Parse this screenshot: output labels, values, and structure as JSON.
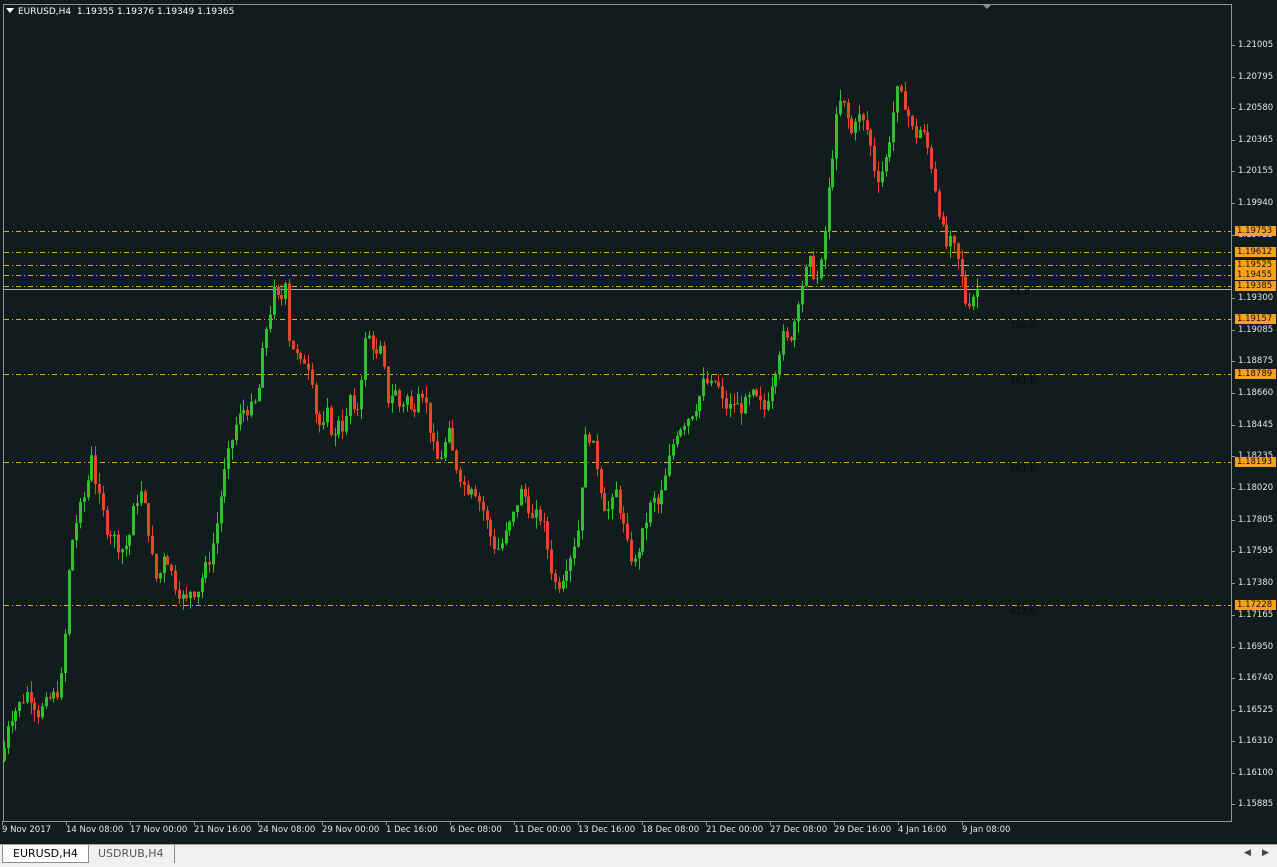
{
  "window": {
    "title_symbol": "EURUSD,H4",
    "title_prices": "1.19355 1.19376 1.19349 1.19365"
  },
  "price_axis": [
    "1.21005",
    "1.20795",
    "1.20580",
    "1.20365",
    "1.20155",
    "1.19940",
    "1.19725",
    "1.19300",
    "1.19085",
    "1.18875",
    "1.18660",
    "1.18445",
    "1.18235",
    "1.18020",
    "1.17805",
    "1.17595",
    "1.17380",
    "1.17165",
    "1.16950",
    "1.16740",
    "1.16525",
    "1.16310",
    "1.16100",
    "1.15885"
  ],
  "time_axis": [
    "9 Nov 2017",
    "14 Nov 08:00",
    "17 Nov 00:00",
    "21 Nov 16:00",
    "24 Nov 08:00",
    "29 Nov 00:00",
    "1 Dec 16:00",
    "6 Dec 08:00",
    "11 Dec 00:00",
    "13 Dec 16:00",
    "18 Dec 08:00",
    "21 Dec 00:00",
    "27 Dec 08:00",
    "29 Dec 16:00",
    "4 Jan 16:00",
    "9 Jan 08:00"
  ],
  "levels": [
    "1.19753",
    "1.19612",
    "1.19525",
    "1.19455",
    "1.19385",
    "1.19157",
    "1.18789",
    "1.18193",
    "1.17228"
  ],
  "fibo_labels": [
    "0.0",
    "61.8",
    "100.0",
    "161.8",
    "261.8",
    "423.6"
  ],
  "colors": {
    "background": "#111d1d",
    "bull": "#2fbf2f",
    "bear": "#e8452a",
    "level": "#f6a21c",
    "axis_text": "#e6e6e6"
  },
  "tabs": [
    "EURUSD,H4",
    "USDRUB,H4"
  ],
  "chart_data": {
    "type": "candlestick",
    "symbol": "EURUSD",
    "timeframe": "H4",
    "ylim": [
      1.1578,
      1.2115
    ],
    "close_points": [
      [
        0,
        1.16
      ],
      [
        10,
        1.1645
      ],
      [
        20,
        1.1655
      ],
      [
        30,
        1.1665
      ],
      [
        40,
        1.165
      ],
      [
        52,
        1.166
      ],
      [
        60,
        1.1665
      ],
      [
        65,
        1.168
      ],
      [
        68,
        1.172
      ],
      [
        72,
        1.176
      ],
      [
        80,
        1.1785
      ],
      [
        88,
        1.18
      ],
      [
        94,
        1.183
      ],
      [
        98,
        1.18
      ],
      [
        103,
        1.179
      ],
      [
        108,
        1.1775
      ],
      [
        115,
        1.177
      ],
      [
        122,
        1.176
      ],
      [
        130,
        1.1765
      ],
      [
        136,
        1.179
      ],
      [
        142,
        1.18
      ],
      [
        148,
        1.1785
      ],
      [
        153,
        1.176
      ],
      [
        157,
        1.174
      ],
      [
        162,
        1.1745
      ],
      [
        166,
        1.176
      ],
      [
        171,
        1.175
      ],
      [
        176,
        1.1738
      ],
      [
        182,
        1.173
      ],
      [
        188,
        1.1725
      ],
      [
        193,
        1.1735
      ],
      [
        198,
        1.173
      ],
      [
        205,
        1.1745
      ],
      [
        212,
        1.1755
      ],
      [
        218,
        1.1775
      ],
      [
        222,
        1.1795
      ],
      [
        227,
        1.1815
      ],
      [
        232,
        1.183
      ],
      [
        238,
        1.1845
      ],
      [
        245,
        1.1855
      ],
      [
        252,
        1.1855
      ],
      [
        258,
        1.186
      ],
      [
        262,
        1.1875
      ],
      [
        266,
        1.1905
      ],
      [
        270,
        1.1915
      ],
      [
        276,
        1.1935
      ],
      [
        282,
        1.1925
      ],
      [
        287,
        1.1945
      ],
      [
        290,
        1.1905
      ],
      [
        296,
        1.1895
      ],
      [
        302,
        1.1885
      ],
      [
        308,
        1.189
      ],
      [
        314,
        1.1875
      ],
      [
        318,
        1.185
      ],
      [
        324,
        1.184
      ],
      [
        330,
        1.1855
      ],
      [
        335,
        1.183
      ],
      [
        340,
        1.185
      ],
      [
        346,
        1.184
      ],
      [
        352,
        1.1865
      ],
      [
        357,
        1.1845
      ],
      [
        362,
        1.187
      ],
      [
        366,
        1.19
      ],
      [
        372,
        1.1905
      ],
      [
        378,
        1.189
      ],
      [
        382,
        1.1895
      ],
      [
        386,
        1.188
      ],
      [
        390,
        1.186
      ],
      [
        396,
        1.187
      ],
      [
        402,
        1.1855
      ],
      [
        408,
        1.1865
      ],
      [
        414,
        1.185
      ],
      [
        420,
        1.187
      ],
      [
        426,
        1.1865
      ],
      [
        432,
        1.184
      ],
      [
        438,
        1.182
      ],
      [
        444,
        1.1825
      ],
      [
        450,
        1.184
      ],
      [
        456,
        1.182
      ],
      [
        462,
        1.181
      ],
      [
        468,
        1.18
      ],
      [
        474,
        1.1805
      ],
      [
        480,
        1.1795
      ],
      [
        486,
        1.1785
      ],
      [
        492,
        1.177
      ],
      [
        498,
        1.176
      ],
      [
        504,
        1.1765
      ],
      [
        510,
        1.1775
      ],
      [
        516,
        1.1785
      ],
      [
        522,
        1.18
      ],
      [
        528,
        1.1795
      ],
      [
        534,
        1.178
      ],
      [
        540,
        1.1785
      ],
      [
        546,
        1.1775
      ],
      [
        552,
        1.175
      ],
      [
        558,
        1.1735
      ],
      [
        563,
        1.174
      ],
      [
        568,
        1.175
      ],
      [
        574,
        1.176
      ],
      [
        580,
        1.1775
      ],
      [
        584,
        1.181
      ],
      [
        588,
        1.184
      ],
      [
        593,
        1.1835
      ],
      [
        598,
        1.182
      ],
      [
        603,
        1.18
      ],
      [
        608,
        1.1785
      ],
      [
        613,
        1.179
      ],
      [
        618,
        1.18
      ],
      [
        624,
        1.178
      ],
      [
        630,
        1.176
      ],
      [
        636,
        1.175
      ],
      [
        642,
        1.1765
      ],
      [
        648,
        1.178
      ],
      [
        654,
        1.1795
      ],
      [
        660,
        1.179
      ],
      [
        666,
        1.1805
      ],
      [
        672,
        1.1825
      ],
      [
        678,
        1.184
      ],
      [
        684,
        1.1845
      ],
      [
        690,
        1.185
      ],
      [
        696,
        1.1855
      ],
      [
        702,
        1.1865
      ],
      [
        706,
        1.1875
      ],
      [
        712,
        1.187
      ],
      [
        718,
        1.1875
      ],
      [
        724,
        1.186
      ],
      [
        730,
        1.1855
      ],
      [
        736,
        1.186
      ],
      [
        742,
        1.1855
      ],
      [
        748,
        1.186
      ],
      [
        754,
        1.1865
      ],
      [
        760,
        1.186
      ],
      [
        766,
        1.1855
      ],
      [
        772,
        1.187
      ],
      [
        778,
        1.1885
      ],
      [
        784,
        1.1905
      ],
      [
        790,
        1.19
      ],
      [
        795,
        1.191
      ],
      [
        800,
        1.193
      ],
      [
        806,
        1.1945
      ],
      [
        812,
        1.1955
      ],
      [
        818,
        1.194
      ],
      [
        824,
        1.1955
      ],
      [
        828,
        1.1985
      ],
      [
        833,
        1.202
      ],
      [
        838,
        1.205
      ],
      [
        843,
        1.2065
      ],
      [
        848,
        1.2055
      ],
      [
        853,
        1.204
      ],
      [
        858,
        1.2055
      ],
      [
        863,
        1.205
      ],
      [
        868,
        1.2045
      ],
      [
        873,
        1.203
      ],
      [
        878,
        1.201
      ],
      [
        883,
        1.2015
      ],
      [
        888,
        1.2025
      ],
      [
        893,
        1.2045
      ],
      [
        898,
        1.207
      ],
      [
        903,
        1.2065
      ],
      [
        908,
        1.206
      ],
      [
        913,
        1.2045
      ],
      [
        918,
        1.204
      ],
      [
        923,
        1.2045
      ],
      [
        928,
        1.2035
      ],
      [
        933,
        1.202
      ],
      [
        938,
        1.2
      ],
      [
        943,
        1.198
      ],
      [
        948,
        1.1965
      ],
      [
        953,
        1.1968
      ],
      [
        958,
        1.196
      ],
      [
        963,
        1.1945
      ],
      [
        968,
        1.1925
      ],
      [
        973,
        1.193
      ],
      [
        978,
        1.1936
      ]
    ]
  }
}
